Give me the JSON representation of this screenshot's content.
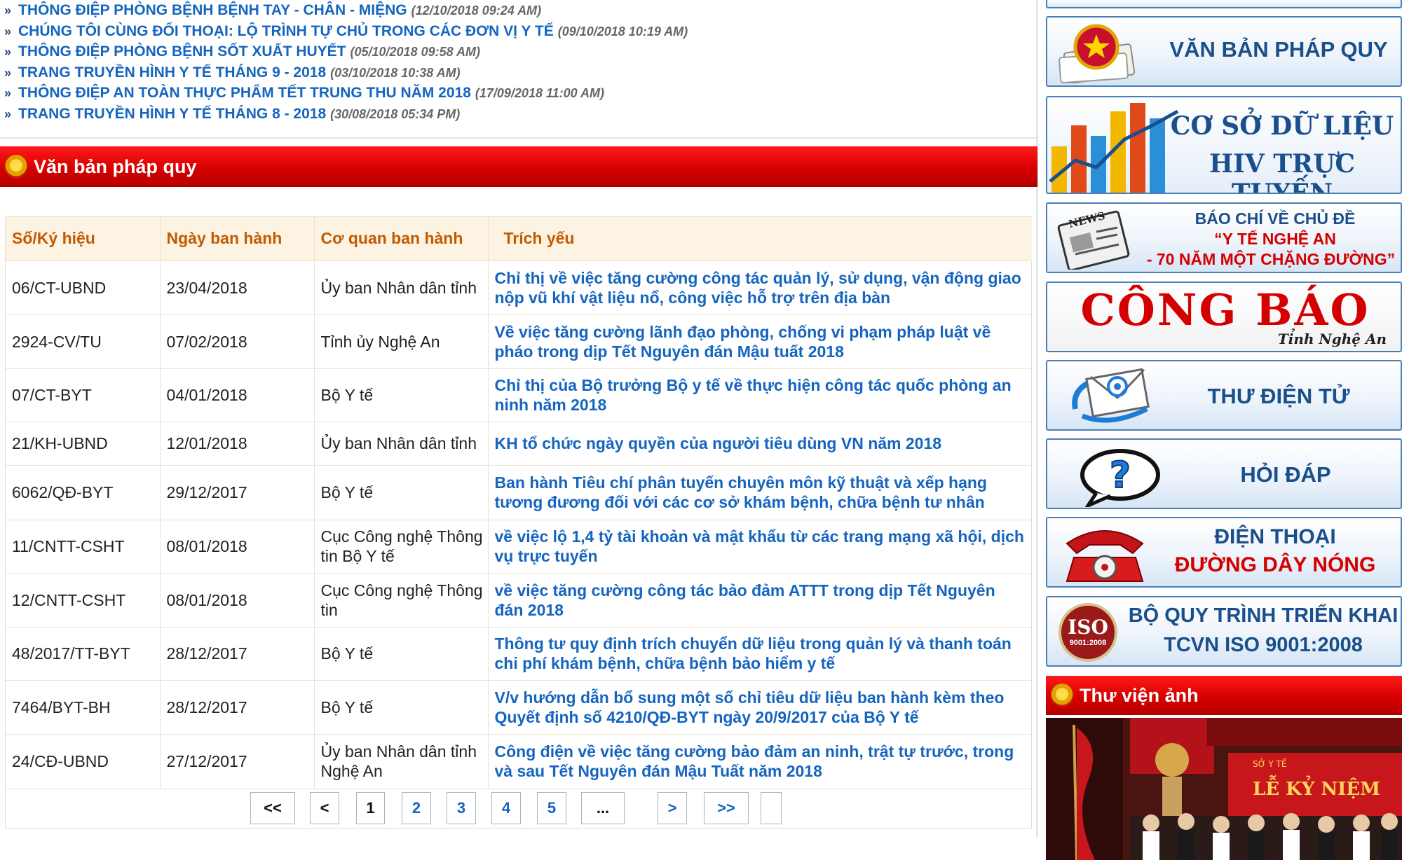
{
  "news": [
    {
      "title": "THÔNG ĐIỆP PHÒNG BỆNH BỆNH TAY - CHÂN - MIỆNG",
      "date": "(12/10/2018 09:24 AM)"
    },
    {
      "title": "CHÚNG TÔI CÙNG ĐỐI THOẠI: LỘ TRÌNH TỰ CHỦ TRONG CÁC ĐƠN VỊ Y TẾ",
      "date": "(09/10/2018 10:19 AM)"
    },
    {
      "title": "THÔNG ĐIỆP PHÒNG BỆNH SỐT XUẤT HUYẾT",
      "date": "(05/10/2018 09:58 AM)"
    },
    {
      "title": "TRANG TRUYỀN HÌNH Y TẾ THÁNG 9 - 2018",
      "date": "(03/10/2018 10:38 AM)"
    },
    {
      "title": "THÔNG ĐIỆP AN TOÀN THỰC PHẨM TẾT TRUNG THU NĂM 2018",
      "date": "(17/09/2018 11:00 AM)"
    },
    {
      "title": "TRANG TRUYỀN HÌNH Y TẾ THÁNG 8 - 2018",
      "date": "(30/08/2018 05:34 PM)"
    }
  ],
  "vbpq_section": {
    "title": "Văn bản pháp quy"
  },
  "table": {
    "headers": [
      "Số/Ký hiệu",
      "Ngày ban hành",
      "Cơ quan ban hành",
      "Trích yếu"
    ],
    "rows": [
      {
        "code": "06/CT-UBND",
        "date": "23/04/2018",
        "agency": "Ủy ban Nhân dân tỉnh",
        "summary": "Chỉ thị về việc tăng cường công tác quản lý, sử dụng, vận động giao nộp vũ khí vật liệu nổ, công việc hỗ trợ trên địa bàn"
      },
      {
        "code": "2924-CV/TU",
        "date": "07/02/2018",
        "agency": "Tỉnh ủy Nghệ An",
        "summary": "Về việc tăng cường lãnh đạo phòng, chống vi phạm pháp luật về pháo trong dịp Tết Nguyên đán Mậu tuất 2018"
      },
      {
        "code": "07/CT-BYT",
        "date": "04/01/2018",
        "agency": "Bộ Y tế",
        "summary": "Chỉ thị của Bộ trưởng Bộ y tế về thực hiện công tác quốc phòng an ninh năm 2018"
      },
      {
        "code": "21/KH-UBND",
        "date": "12/01/2018",
        "agency": "Ủy ban Nhân dân tỉnh",
        "summary": "KH tổ chức ngày quyền của người tiêu dùng VN năm 2018"
      },
      {
        "code": "6062/QĐ-BYT",
        "date": "29/12/2017",
        "agency": "Bộ Y tế",
        "summary": "Ban hành Tiêu chí phân tuyến chuyên môn kỹ thuật và xếp hạng tương đương đối với các cơ sở khám bệnh, chữa bệnh tư nhân"
      },
      {
        "code": "11/CNTT-CSHT",
        "date": "08/01/2018",
        "agency": "Cục Công nghệ Thông tin Bộ Y tế",
        "summary": "về việc lộ 1,4 tỷ tài khoản và mật khẩu từ các trang mạng xã hội, dịch vụ trực tuyến"
      },
      {
        "code": "12/CNTT-CSHT",
        "date": "08/01/2018",
        "agency": "Cục Công nghệ Thông tin",
        "summary": "về việc tăng cường công tác bảo đảm ATTT trong dịp Tết Nguyên đán 2018"
      },
      {
        "code": "48/2017/TT-BYT",
        "date": "28/12/2017",
        "agency": "Bộ Y tế",
        "summary": "Thông tư quy định trích chuyển dữ liệu trong quản lý và thanh toán chi phí khám bệnh, chữa bệnh bảo hiểm y tế"
      },
      {
        "code": "7464/BYT-BH",
        "date": "28/12/2017",
        "agency": "Bộ Y tế",
        "summary": "V/v hướng dẫn bổ sung một số chỉ tiêu dữ liệu ban hành kèm theo Quyết định số 4210/QĐ-BYT ngày 20/9/2017 của Bộ Y tế"
      },
      {
        "code": "24/CĐ-UBND",
        "date": "27/12/2017",
        "agency": "Ủy ban Nhân dân tỉnh Nghệ An",
        "summary": "Công điện về việc tăng cường bảo đảm an ninh, trật tự trước, trong và sau Tết Nguyên đán Mậu Tuất năm 2018"
      }
    ]
  },
  "pager": {
    "first": "<<",
    "prev": "<",
    "pages": [
      "1",
      "2",
      "3",
      "4",
      "5"
    ],
    "ellipsis": "...",
    "next": ">",
    "last": ">>",
    "current": "1"
  },
  "sidebar": {
    "vbpq": "VĂN BẢN PHÁP QUY",
    "csdl_line1": "CƠ SỞ DỮ LIỆU",
    "csdl_line2": "HIV TRỰC TUYẾN",
    "baochi_line1": "BÁO CHÍ VỀ CHỦ ĐỀ",
    "baochi_line2": "“Y TẾ NGHỆ AN",
    "baochi_line3": "- 70 NĂM MỘT CHẶNG ĐƯỜNG”",
    "news_stamp": "NEWS",
    "congbao": "CÔNG BÁO",
    "congbao_sub": "Tỉnh Nghệ An",
    "mail": "THƯ ĐIỆN TỬ",
    "hoidap": "HỎI ĐÁP",
    "dienthoai_line1": "ĐIỆN THOẠI",
    "dienthoai_line2": "ĐƯỜNG DÂY NÓNG",
    "iso_badge": "ISO",
    "iso_badge_sub": "9001:2008",
    "iso_line1": "BỘ QUY TRÌNH TRIỂN KHAI",
    "iso_line2": "TCVN ISO 9001:2008",
    "library_title": "Thư viện ảnh",
    "photo_banner_line1": "LỄ KỶ NIỆM"
  }
}
